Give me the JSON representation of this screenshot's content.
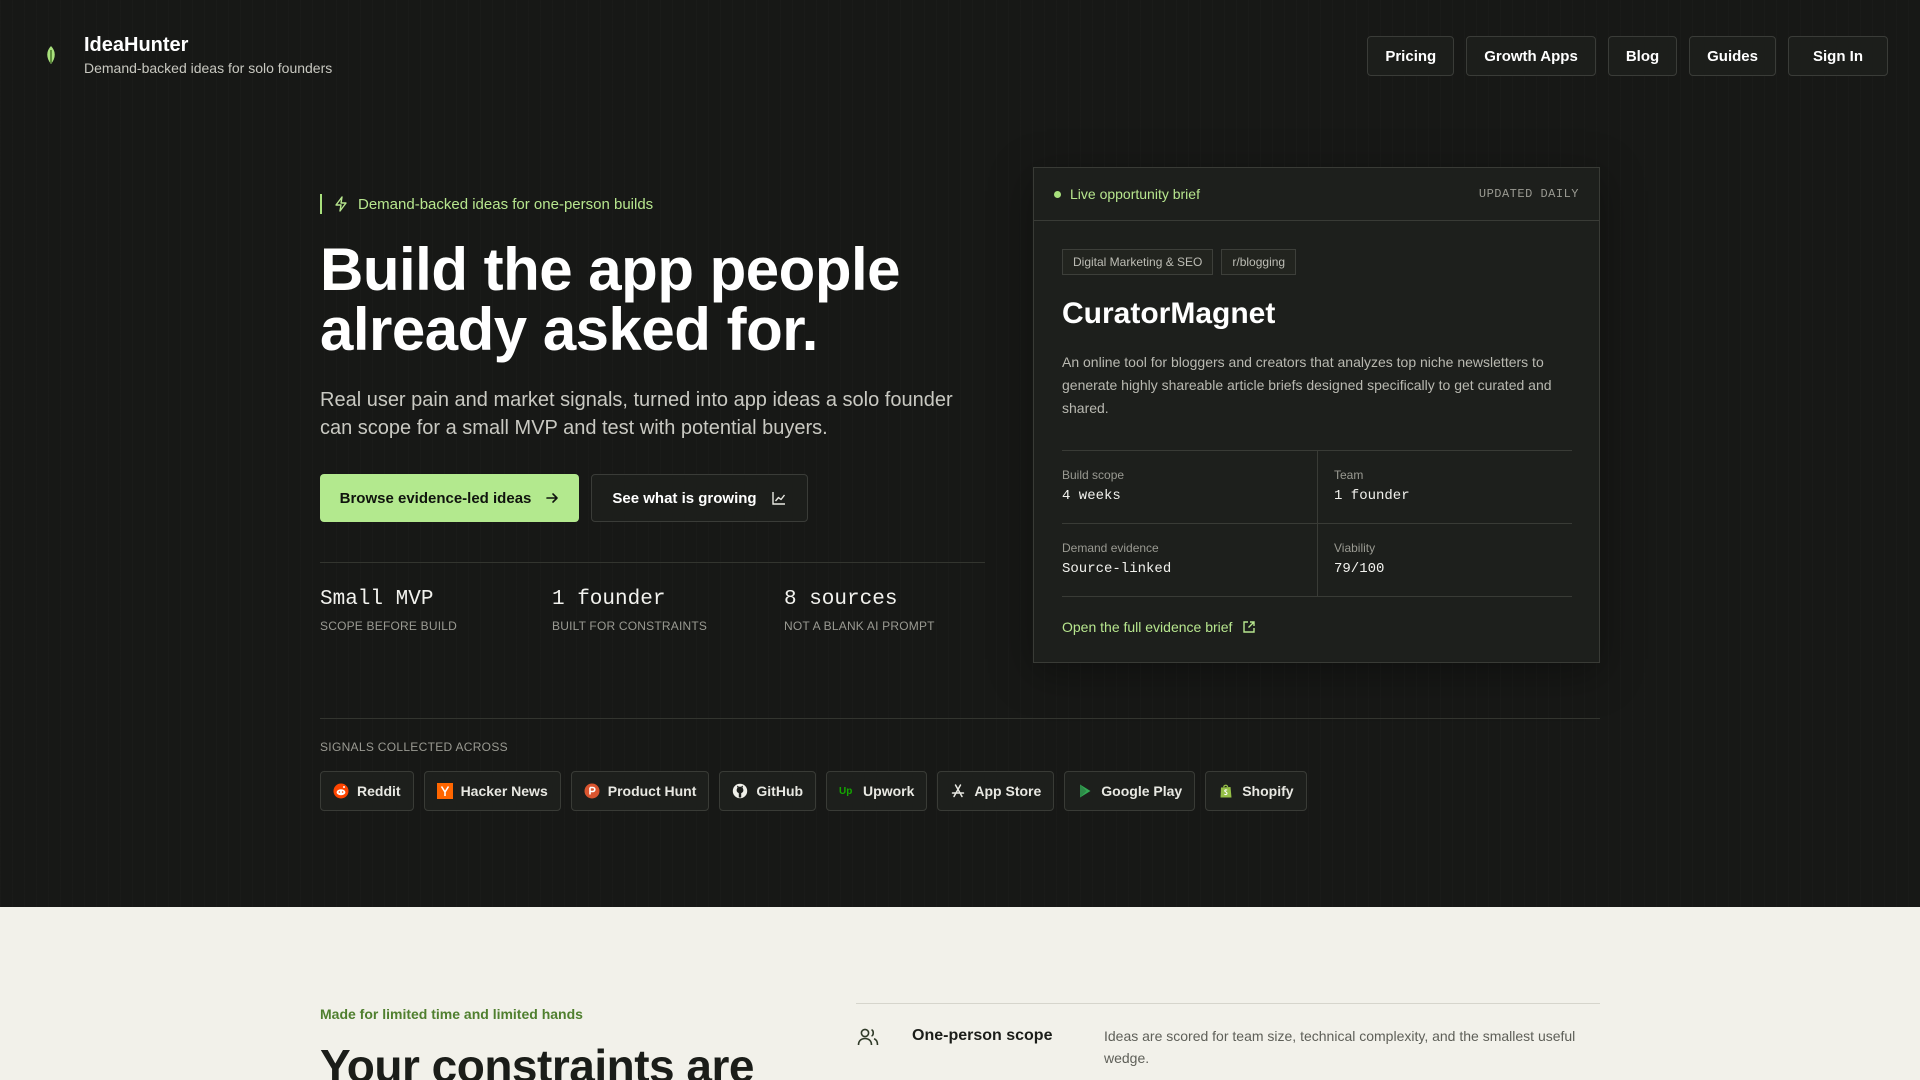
{
  "brand": {
    "name": "IdeaHunter",
    "tagline": "Demand-backed ideas for solo founders"
  },
  "nav": {
    "items": [
      "Pricing",
      "Growth Apps",
      "Blog",
      "Guides"
    ],
    "signin": "Sign In"
  },
  "hero": {
    "eyebrow": "Demand-backed ideas for one-person builds",
    "headline": "Build the app people already asked for.",
    "subhead": "Real user pain and market signals, turned into app ideas a solo founder can scope for a small MVP and test with potential buyers.",
    "cta_primary": "Browse evidence-led ideas",
    "cta_secondary": "See what is growing",
    "stats": [
      {
        "value": "Small MVP",
        "label": "SCOPE BEFORE BUILD"
      },
      {
        "value": "1 founder",
        "label": "BUILT FOR CONSTRAINTS"
      },
      {
        "value": "8 sources",
        "label": "NOT A BLANK AI PROMPT"
      }
    ]
  },
  "brief": {
    "live_label": "Live opportunity brief",
    "updated": "UPDATED DAILY",
    "tags": [
      "Digital Marketing & SEO",
      "r/blogging"
    ],
    "title": "CuratorMagnet",
    "description": "An online tool for bloggers and creators that analyzes top niche newsletters to generate highly shareable article briefs designed specifically to get curated and shared.",
    "metrics": [
      {
        "label": "Build scope",
        "value": "4 weeks"
      },
      {
        "label": "Team",
        "value": "1 founder"
      },
      {
        "label": "Demand evidence",
        "value": "Source-linked"
      },
      {
        "label": "Viability",
        "value": "79/100"
      }
    ],
    "link": "Open the full evidence brief"
  },
  "signals": {
    "label": "SIGNALS COLLECTED ACROSS",
    "sources": [
      {
        "name": "Reddit",
        "icon": "reddit-icon"
      },
      {
        "name": "Hacker News",
        "icon": "hacker-news-icon"
      },
      {
        "name": "Product Hunt",
        "icon": "product-hunt-icon"
      },
      {
        "name": "GitHub",
        "icon": "github-icon"
      },
      {
        "name": "Upwork",
        "icon": "upwork-icon"
      },
      {
        "name": "App Store",
        "icon": "app-store-icon"
      },
      {
        "name": "Google Play",
        "icon": "google-play-icon"
      },
      {
        "name": "Shopify",
        "icon": "shopify-icon"
      }
    ]
  },
  "constraints": {
    "eyebrow": "Made for limited time and limited hands",
    "heading": "Your constraints are",
    "feature": {
      "title": "One-person scope",
      "description": "Ideas are scored for team size, technical complexity, and the smallest useful wedge."
    }
  },
  "colors": {
    "accent": "#b3e98e",
    "background_dark": "#171816",
    "background_light": "#f2f1ea"
  }
}
